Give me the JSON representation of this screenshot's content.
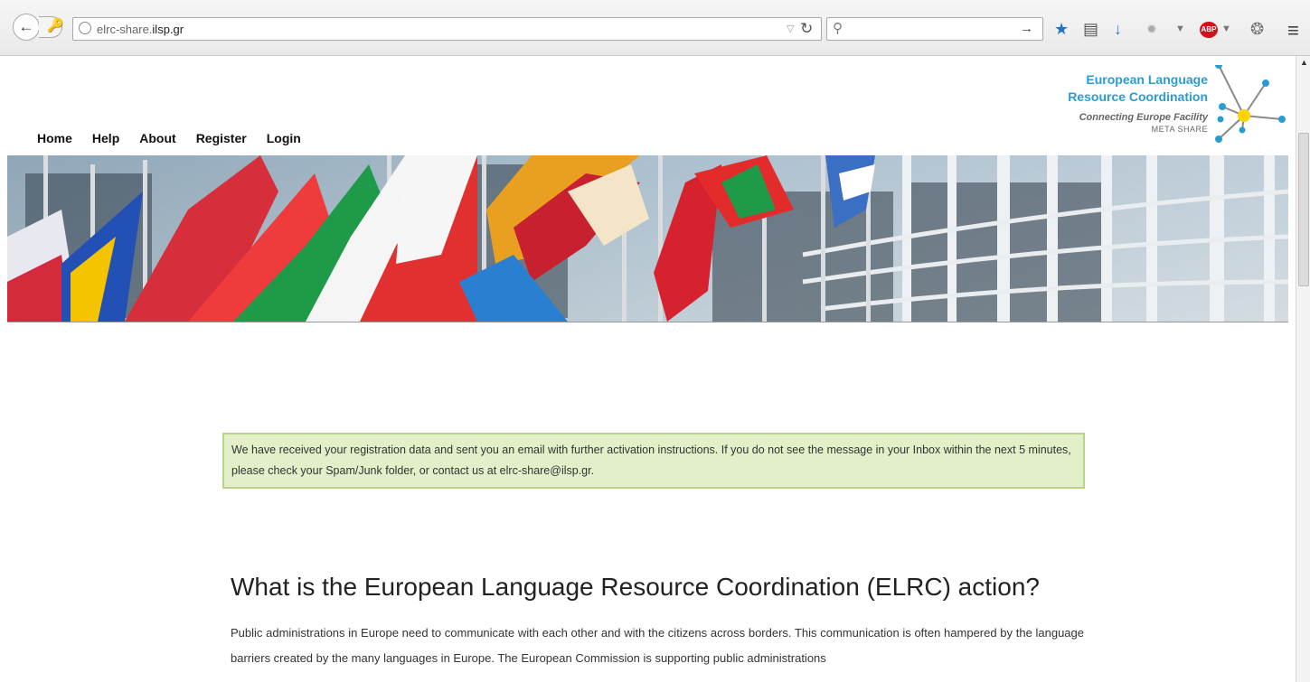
{
  "browser": {
    "url_prefix": "elrc-share.",
    "url_domain": "ilsp.gr",
    "search_placeholder": "",
    "icons": [
      "back-icon",
      "forward-icon",
      "key-icon",
      "globe-icon",
      "reload-icon",
      "search-icon",
      "star-icon",
      "reading-list-icon",
      "download-icon",
      "extension-icon",
      "adblock-icon",
      "vpn-icon",
      "menu-icon"
    ],
    "adblock_label": "ABP"
  },
  "nav": {
    "items": [
      {
        "label": "Home"
      },
      {
        "label": "Help"
      },
      {
        "label": "About"
      },
      {
        "label": "Register"
      },
      {
        "label": "Login"
      }
    ]
  },
  "logo": {
    "line1": "European Language",
    "line2": "Resource Coordination",
    "line3": "Connecting Europe Facility",
    "line4": "META SHARE",
    "accent_color": "#2b9ccf",
    "node_color": "#ffd400"
  },
  "notice": {
    "text": "We have received your registration data and sent you an email with further activation instructions. If you do not see the message in your Inbox within the next 5 minutes, please check your Spam/Junk folder, or contact us at elrc-share@ilsp.gr.",
    "bg_color": "#e2efc8",
    "border_color": "#b9d38a"
  },
  "main": {
    "heading": "What is the European Language Resource Coordination (ELRC) action?",
    "paragraph": "Public administrations in Europe need to communicate with each other and with the citizens across borders. This communication is often hampered by the language barriers created by the many languages in Europe. The European Commission is supporting public administrations"
  }
}
